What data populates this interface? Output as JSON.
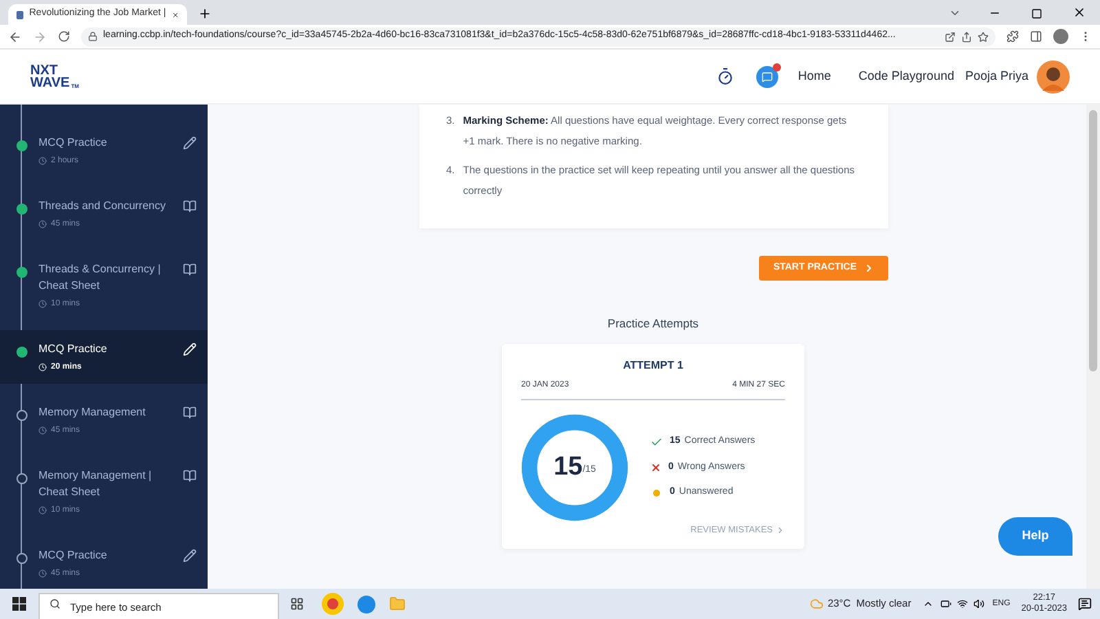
{
  "browser": {
    "tab_title": "Revolutionizing the Job Market |",
    "url": "learning.ccbp.in/tech-foundations/course?c_id=33a45745-2b2a-4d60-bc16-83ca731081f3&t_id=b2a376dc-15c5-4c58-83d0-62e751bf6879&s_id=28687ffc-cd18-4bc1-9183-53311d4462..."
  },
  "header": {
    "logo_top": "NXT",
    "logo_bottom": "WAVE",
    "logo_mark": "TM",
    "notification": true,
    "nav": [
      "Home",
      "Code Playground"
    ],
    "user_name": "Pooja Priya"
  },
  "sidebar": {
    "items": [
      {
        "title": "MCQ Practice",
        "duration": "2 hours",
        "kind": "practice",
        "completed": true,
        "selected": false
      },
      {
        "title": "Threads and Concurrency",
        "duration": "45 mins",
        "kind": "reading",
        "completed": true,
        "selected": false
      },
      {
        "title": "Threads & Concurrency | Cheat Sheet",
        "duration": "10 mins",
        "kind": "reading",
        "completed": true,
        "selected": false
      },
      {
        "title": "MCQ Practice",
        "duration": "20 mins",
        "kind": "practice",
        "completed": true,
        "selected": true
      },
      {
        "title": "Memory Management",
        "duration": "45 mins",
        "kind": "reading",
        "completed": false,
        "selected": false
      },
      {
        "title": "Memory Management | Cheat Sheet",
        "duration": "10 mins",
        "kind": "reading",
        "completed": false,
        "selected": false
      },
      {
        "title": "MCQ Practice",
        "duration": "45 mins",
        "kind": "practice",
        "completed": false,
        "selected": false
      }
    ]
  },
  "instructions": [
    {
      "number": "3.",
      "text": "**Marking Scheme:**  All questions have equal weightage. Every correct response gets +1 mark. There is no negative marking."
    },
    {
      "number": "4.",
      "text": "The questions in the practice set will keep repeating until you answer all the questions correctly"
    }
  ],
  "start_button": "START PRACTICE",
  "attempts_heading": "Practice Attempts",
  "attempt": {
    "title": "ATTEMPT 1",
    "date": "20 JAN 2023",
    "time_taken": "4 MIN 27 SEC",
    "score": "15",
    "total": "/15",
    "level": 1,
    "stats": [
      {
        "kind": "correct",
        "count": "15",
        "label": "Correct Answers"
      },
      {
        "kind": "wrong",
        "count": "0",
        "label": "Wrong Answers"
      },
      {
        "kind": "unanswered",
        "count": "0",
        "label": "Unanswered"
      }
    ],
    "review": "REVIEW MISTAKES"
  },
  "help_button": "Help",
  "taskbar": {
    "search_placeholder": "Type here to search",
    "temperature": "23°C",
    "weather": "Mostly clear",
    "language": "ENG",
    "time": "22:17",
    "date": "20-01-2023"
  }
}
